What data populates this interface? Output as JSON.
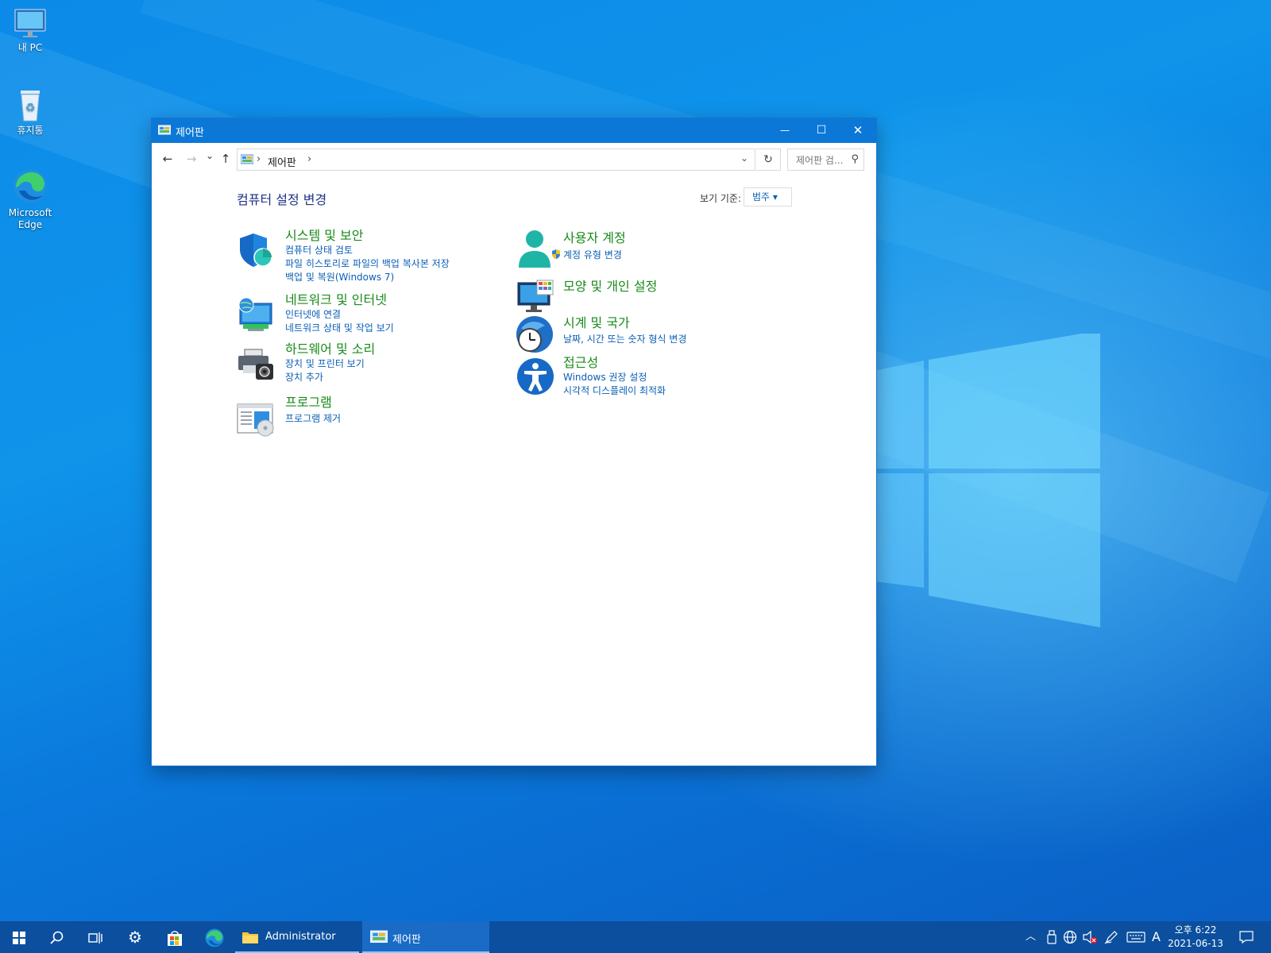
{
  "desktop": {
    "icons": [
      {
        "label": "내 PC"
      },
      {
        "label": "휴지통"
      },
      {
        "label": "Microsoft Edge"
      }
    ]
  },
  "window": {
    "title": "제어판",
    "controls": {
      "minimize": "—",
      "maximize": "☐",
      "close": "✕"
    },
    "nav": {
      "back": "←",
      "forward": "→",
      "recent": "⌄",
      "up": "↑",
      "crumb_sep": "›",
      "breadcrumb": "제어판",
      "dropdown": "⌄",
      "refresh": "↻",
      "search_placeholder": "제어판 검..."
    },
    "heading": "컴퓨터 설정 변경",
    "view_by_label": "보기 기준:",
    "view_by_value": "범주 ▾",
    "categories_left": [
      {
        "title": "시스템 및 보안",
        "links": [
          "컴퓨터 상태 검토",
          "파일 히스토리로 파일의 백업 복사본 저장",
          "백업 및 복원(Windows 7)"
        ]
      },
      {
        "title": "네트워크 및 인터넷",
        "links": [
          "인터넷에 연결",
          "네트워크 상태 및 작업 보기"
        ]
      },
      {
        "title": "하드웨어 및 소리",
        "links": [
          "장치 및 프린터 보기",
          "장치 추가"
        ]
      },
      {
        "title": "프로그램",
        "links": [
          "프로그램 제거"
        ]
      }
    ],
    "categories_right": [
      {
        "title": "사용자 계정",
        "links": [
          "계정 유형 변경"
        ]
      },
      {
        "title": "모양 및 개인 설정",
        "links": []
      },
      {
        "title": "시계 및 국가",
        "links": [
          "날짜, 시간 또는 숫자 형식 변경"
        ]
      },
      {
        "title": "접근성",
        "links": [
          "Windows 권장 설정",
          "시각적 디스플레이 최적화"
        ]
      }
    ]
  },
  "taskbar": {
    "apps": [
      {
        "label": "Administrator"
      },
      {
        "label": "제어판"
      }
    ],
    "tray": {
      "ime": "A"
    },
    "clock": {
      "time": "오후 6:22",
      "date": "2021-06-13"
    }
  },
  "colors": {
    "accent": "#0b78d8",
    "taskbar": "#0c4f9e",
    "category_title": "#1a8a1a",
    "link": "#0a5fb5"
  }
}
